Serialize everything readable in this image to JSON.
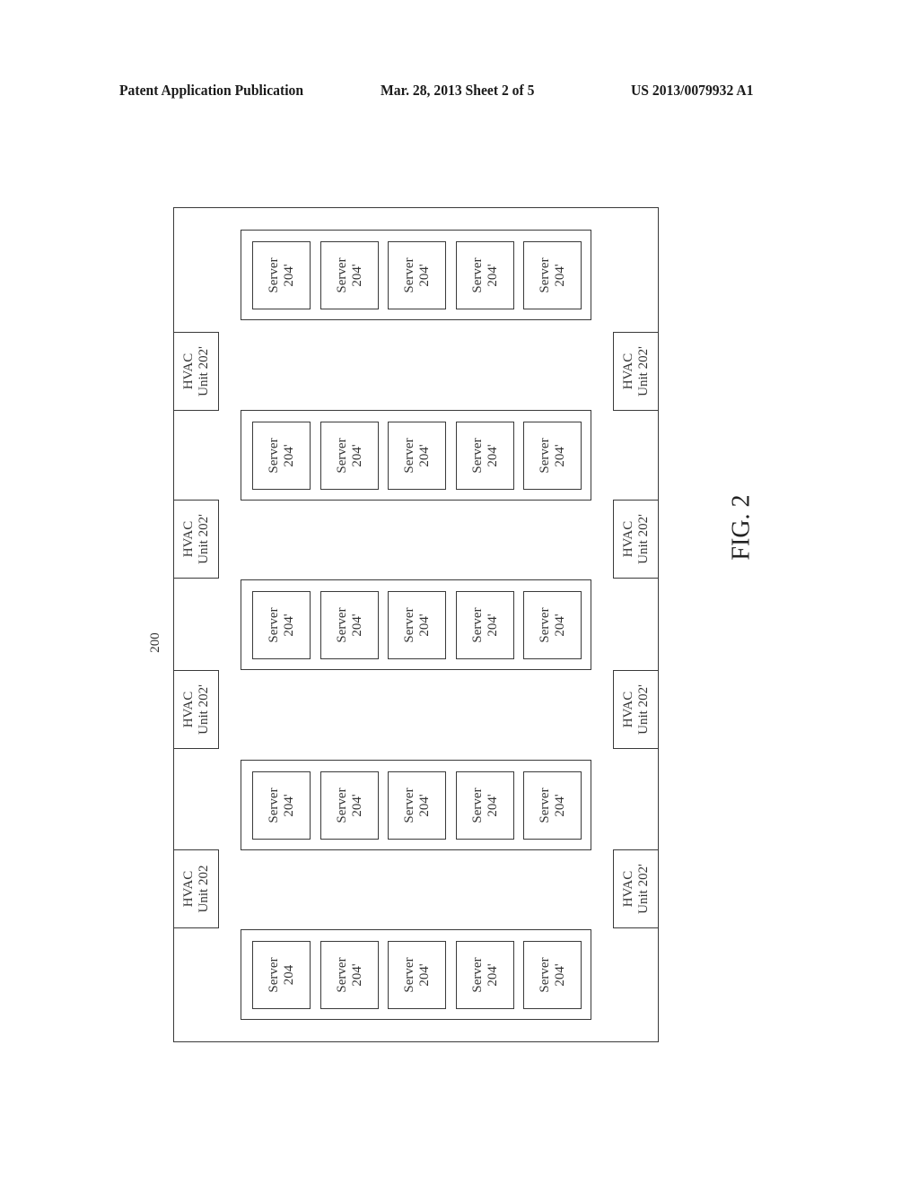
{
  "header": {
    "left": "Patent Application Publication",
    "middle": "Mar. 28, 2013  Sheet 2 of 5",
    "right": "US 2013/0079932 A1"
  },
  "figure": {
    "reference_label": "200",
    "caption": "FIG. 2",
    "hvac_units": {
      "left": [
        {
          "line1": "HVAC",
          "line2": "Unit 202'"
        },
        {
          "line1": "HVAC",
          "line2": "Unit 202'"
        },
        {
          "line1": "HVAC",
          "line2": "Unit 202'"
        },
        {
          "line1": "HVAC",
          "line2": "Unit 202"
        }
      ],
      "right": [
        {
          "line1": "HVAC",
          "line2": "Unit 202'"
        },
        {
          "line1": "HVAC",
          "line2": "Unit 202'"
        },
        {
          "line1": "HVAC",
          "line2": "Unit 202'"
        },
        {
          "line1": "HVAC",
          "line2": "Unit 202'"
        }
      ]
    },
    "racks": [
      {
        "servers": [
          {
            "line1": "Server",
            "line2": "204'"
          },
          {
            "line1": "Server",
            "line2": "204'"
          },
          {
            "line1": "Server",
            "line2": "204'"
          },
          {
            "line1": "Server",
            "line2": "204'"
          },
          {
            "line1": "Server",
            "line2": "204'"
          }
        ]
      },
      {
        "servers": [
          {
            "line1": "Server",
            "line2": "204'"
          },
          {
            "line1": "Server",
            "line2": "204'"
          },
          {
            "line1": "Server",
            "line2": "204'"
          },
          {
            "line1": "Server",
            "line2": "204'"
          },
          {
            "line1": "Server",
            "line2": "204'"
          }
        ]
      },
      {
        "servers": [
          {
            "line1": "Server",
            "line2": "204'"
          },
          {
            "line1": "Server",
            "line2": "204'"
          },
          {
            "line1": "Server",
            "line2": "204'"
          },
          {
            "line1": "Server",
            "line2": "204'"
          },
          {
            "line1": "Server",
            "line2": "204'"
          }
        ]
      },
      {
        "servers": [
          {
            "line1": "Server",
            "line2": "204'"
          },
          {
            "line1": "Server",
            "line2": "204'"
          },
          {
            "line1": "Server",
            "line2": "204'"
          },
          {
            "line1": "Server",
            "line2": "204'"
          },
          {
            "line1": "Server",
            "line2": "204'"
          }
        ]
      },
      {
        "servers": [
          {
            "line1": "Server",
            "line2": "204"
          },
          {
            "line1": "Server",
            "line2": "204'"
          },
          {
            "line1": "Server",
            "line2": "204'"
          },
          {
            "line1": "Server",
            "line2": "204'"
          },
          {
            "line1": "Server",
            "line2": "204'"
          }
        ]
      }
    ]
  }
}
